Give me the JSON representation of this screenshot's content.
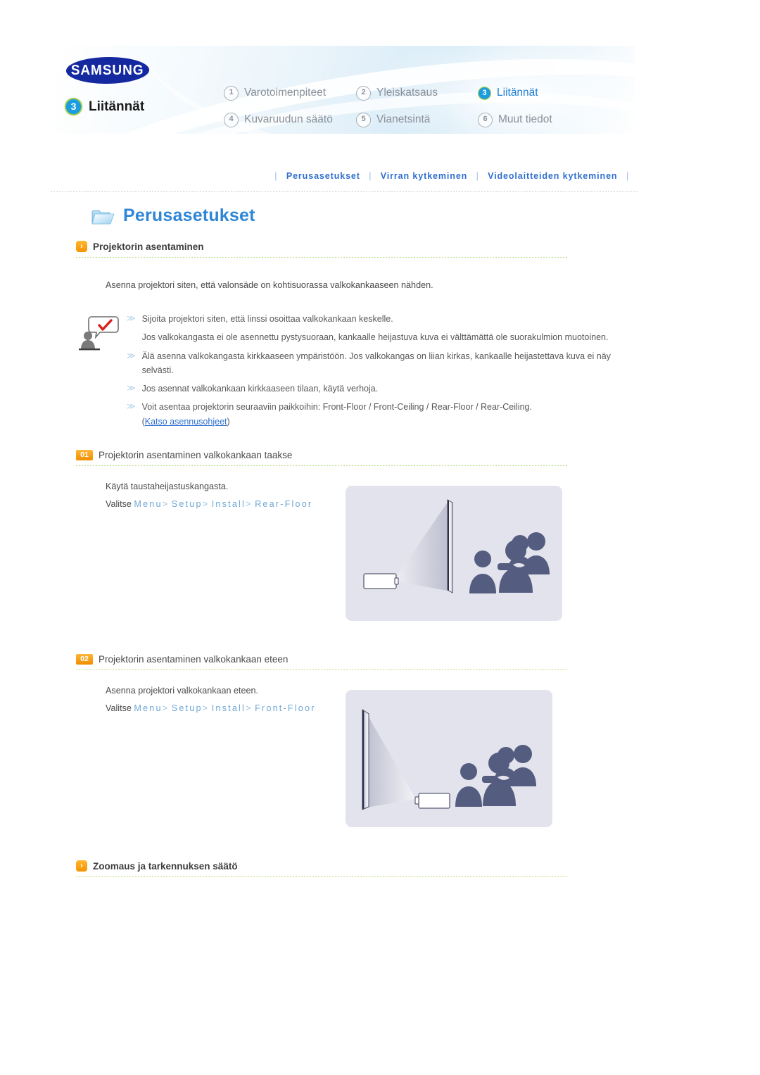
{
  "header": {
    "brand": "SAMSUNG",
    "chapter_number": "3",
    "chapter_name": "Liitännät",
    "nav_items": [
      {
        "num": "1",
        "label": "Varotoimenpiteet",
        "active": false
      },
      {
        "num": "2",
        "label": "Yleiskatsaus",
        "active": false
      },
      {
        "num": "3",
        "label": "Liitännät",
        "active": true
      },
      {
        "num": "4",
        "label": "Kuvaruudun säätö",
        "active": false
      },
      {
        "num": "5",
        "label": "Vianetsintä",
        "active": false
      },
      {
        "num": "6",
        "label": "Muut tiedot",
        "active": false
      }
    ]
  },
  "subnav": {
    "items": [
      "Perusasetukset",
      "Virran kytkeminen",
      "Videolaitteiden kytkeminen"
    ],
    "separator": "|"
  },
  "page": {
    "title": "Perusasetukset",
    "folder_icon": "folder-icon"
  },
  "section1": {
    "marker_icon": "orange-chevron-icon",
    "heading": "Projektorin asentaminen",
    "intro": "Asenna projektori siten, että valonsäde on kohtisuorassa valkokankaaseen nähden.",
    "notice_icon": "person-speech-check-icon",
    "notices": [
      "Sijoita projektori siten, että linssi osoittaa valkokankaan keskelle.",
      "Jos valkokangasta ei ole asennettu pystysuoraan, kankaalle heijastuva kuva ei välttämättä ole suorakulmion muotoinen.",
      "Älä asenna valkokangasta kirkkaaseen ympäristöön. Jos valkokangas on liian kirkas, kankaalle heijastettava kuva ei näy selvästi.",
      "Jos asennat valkokankaan kirkkaaseen tilaan, käytä verhoja.",
      "Voit asentaa projektorin seuraaviin paikkoihin: Front-Floor / Front-Ceiling / Rear-Floor / Rear-Ceiling."
    ],
    "link_text": "Katso asennusohjeet",
    "link_open": "(",
    "link_close": ")"
  },
  "step1": {
    "badge": "01",
    "heading": "Projektorin asentaminen valkokankaan taakse",
    "line1": "Käytä taustaheijastuskangasta.",
    "line2_prefix": "Valitse ",
    "path": [
      "Menu",
      "Setup",
      "Install",
      "Rear-Floor"
    ],
    "path_sep": ">",
    "illustration": "rear-floor-projection-diagram"
  },
  "step2": {
    "badge": "02",
    "heading": "Projektorin asentaminen valkokankaan eteen",
    "line1": "Asenna projektori valkokankaan eteen.",
    "line2_prefix": "Valitse ",
    "path": [
      "Menu",
      "Setup",
      "Install",
      "Front-Floor"
    ],
    "path_sep": ">",
    "illustration": "front-floor-projection-diagram"
  },
  "section2": {
    "marker_icon": "orange-chevron-icon",
    "heading": "Zoomaus ja tarkennuksen säätö"
  },
  "colors": {
    "brand_blue": "#1428a0",
    "link_blue": "#2f6fd0",
    "title_blue": "#2f86d6",
    "accent_orange": "#f59300",
    "rule_green": "#b9dd7a",
    "illus_bg": "#e2e3ec",
    "silhouette": "#545c80"
  }
}
